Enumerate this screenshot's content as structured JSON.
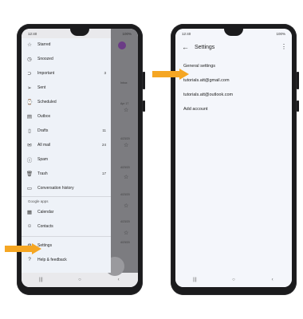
{
  "left_phone": {
    "status": {
      "time": "12:40",
      "battery": "100%"
    },
    "drawer": {
      "items": [
        {
          "icon": "star-icon",
          "label": "Starred",
          "count": ""
        },
        {
          "icon": "clock-icon",
          "label": "Snoozed",
          "count": ""
        },
        {
          "icon": "important-icon",
          "label": "Important",
          "count": "3"
        },
        {
          "icon": "send-icon",
          "label": "Sent",
          "count": ""
        },
        {
          "icon": "scheduled-icon",
          "label": "Scheduled",
          "count": ""
        },
        {
          "icon": "outbox-icon",
          "label": "Outbox",
          "count": ""
        },
        {
          "icon": "draft-icon",
          "label": "Drafts",
          "count": "11"
        },
        {
          "icon": "all-mail-icon",
          "label": "All mail",
          "count": "24"
        },
        {
          "icon": "spam-icon",
          "label": "Spam",
          "count": ""
        },
        {
          "icon": "trash-icon",
          "label": "Trash",
          "count": "17"
        },
        {
          "icon": "conversation-icon",
          "label": "Conversation history",
          "count": ""
        }
      ],
      "section_google_apps": "Google apps",
      "apps": [
        {
          "icon": "calendar-icon",
          "label": "Calendar"
        },
        {
          "icon": "contacts-icon",
          "label": "Contacts"
        }
      ],
      "settings_label": "Settings",
      "help_label": "Help & feedback"
    },
    "background_inbox": {
      "snippets": [
        "Inbox",
        "Apr 17",
        "4/23/20",
        "4/23/20",
        "4/23/20",
        "4/23/20",
        "4/23/20"
      ]
    }
  },
  "right_phone": {
    "status": {
      "time": "12:40",
      "battery": "100%"
    },
    "header_title": "Settings",
    "items": [
      "General settings",
      "tutorials.att@gmail.com",
      "tutorials.att@outlook.com",
      "Add account"
    ]
  },
  "colors": {
    "arrow": "#f5a623",
    "phone_body": "#1b1b1d",
    "drawer_bg": "#eef2f8",
    "avatar": "#6b3c86"
  }
}
